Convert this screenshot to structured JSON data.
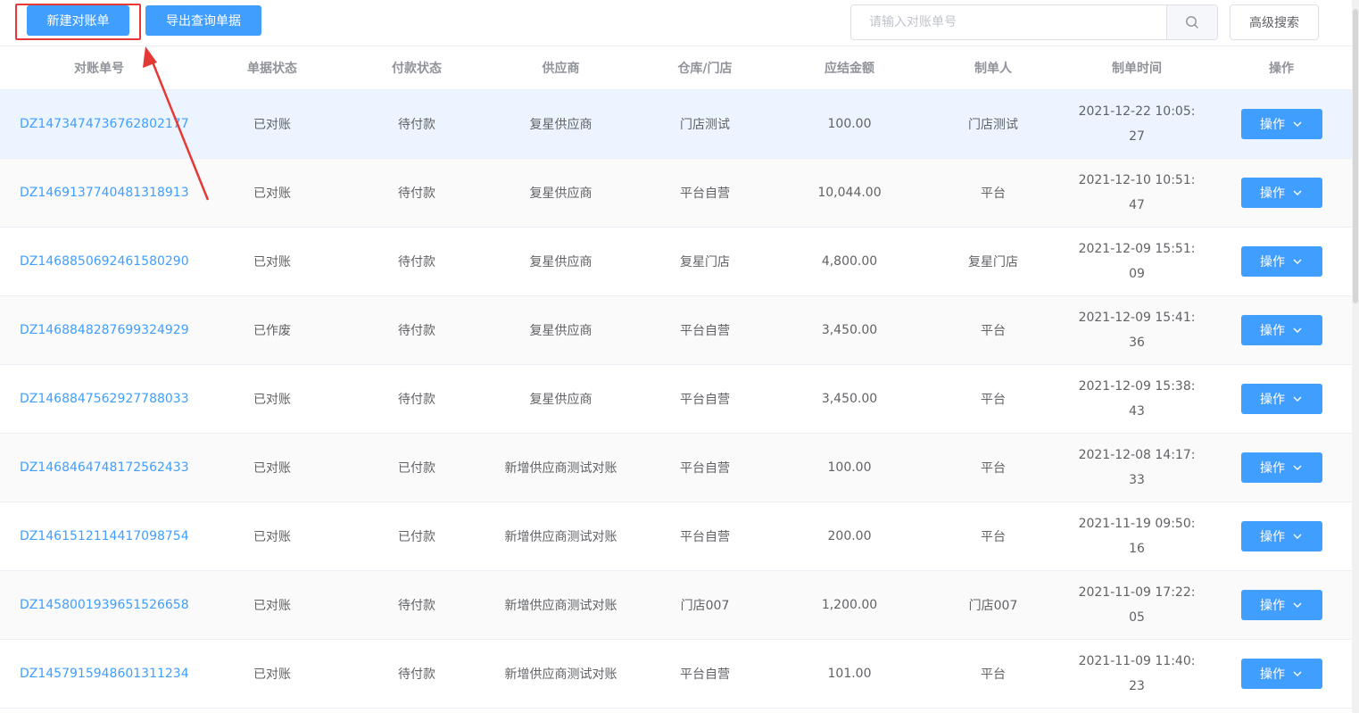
{
  "toolbar": {
    "new_label": "新建对账单",
    "export_label": "导出查询单据",
    "search_placeholder": "请输入对账单号",
    "advanced_label": "高级搜索"
  },
  "table": {
    "headers": [
      "对账单号",
      "单据状态",
      "付款状态",
      "供应商",
      "仓库/门店",
      "应结金额",
      "制单人",
      "制单时间",
      "操作"
    ],
    "action_label": "操作",
    "rows": [
      {
        "no": "DZ1473474736762802177",
        "status": "已对账",
        "pay": "待付款",
        "supplier": "复星供应商",
        "store": "门店测试",
        "amount": "100.00",
        "creator": "门店测试",
        "time": "2021-12-22 10:05:27"
      },
      {
        "no": "DZ1469137740481318913",
        "status": "已对账",
        "pay": "待付款",
        "supplier": "复星供应商",
        "store": "平台自营",
        "amount": "10,044.00",
        "creator": "平台",
        "time": "2021-12-10 10:51:47"
      },
      {
        "no": "DZ1468850692461580290",
        "status": "已对账",
        "pay": "待付款",
        "supplier": "复星供应商",
        "store": "复星门店",
        "amount": "4,800.00",
        "creator": "复星门店",
        "time": "2021-12-09 15:51:09"
      },
      {
        "no": "DZ1468848287699324929",
        "status": "已作废",
        "pay": "待付款",
        "supplier": "复星供应商",
        "store": "平台自营",
        "amount": "3,450.00",
        "creator": "平台",
        "time": "2021-12-09 15:41:36"
      },
      {
        "no": "DZ1468847562927788033",
        "status": "已对账",
        "pay": "待付款",
        "supplier": "复星供应商",
        "store": "平台自营",
        "amount": "3,450.00",
        "creator": "平台",
        "time": "2021-12-09 15:38:43"
      },
      {
        "no": "DZ1468464748172562433",
        "status": "已对账",
        "pay": "已付款",
        "supplier": "新增供应商测试对账",
        "store": "平台自营",
        "amount": "100.00",
        "creator": "平台",
        "time": "2021-12-08 14:17:33"
      },
      {
        "no": "DZ1461512114417098754",
        "status": "已对账",
        "pay": "已付款",
        "supplier": "新增供应商测试对账",
        "store": "平台自营",
        "amount": "200.00",
        "creator": "平台",
        "time": "2021-11-19 09:50:16"
      },
      {
        "no": "DZ1458001939651526658",
        "status": "已对账",
        "pay": "待付款",
        "supplier": "新增供应商测试对账",
        "store": "门店007",
        "amount": "1,200.00",
        "creator": "门店007",
        "time": "2021-11-09 17:22:05"
      },
      {
        "no": "DZ1457915948601311234",
        "status": "已对账",
        "pay": "待付款",
        "supplier": "新增供应商测试对账",
        "store": "平台自营",
        "amount": "101.00",
        "creator": "平台",
        "time": "2021-11-09 11:40:23"
      }
    ]
  },
  "colors": {
    "primary": "#409eff",
    "annotation": "#e53935",
    "row_hover": "#ecf5ff"
  },
  "icons": {
    "search": "search-icon",
    "dropdown": "chevron-down-icon"
  }
}
